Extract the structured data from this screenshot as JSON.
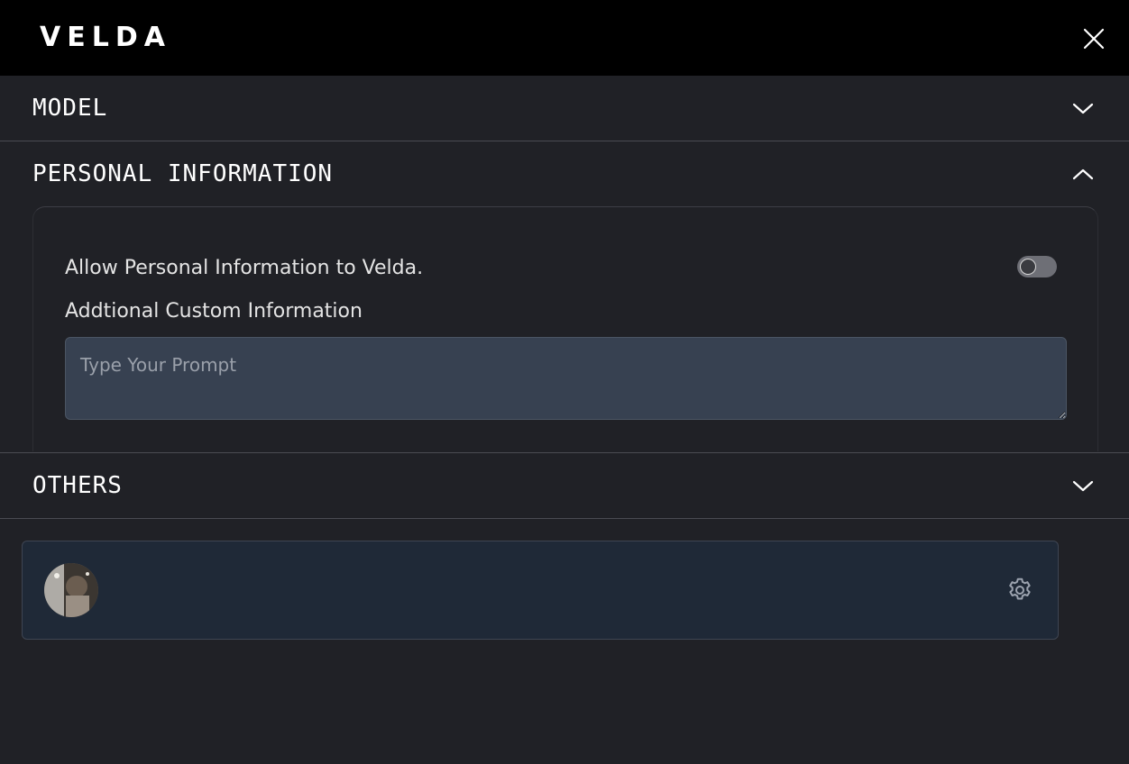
{
  "header": {
    "logo_text": "VELDA"
  },
  "sections": {
    "model": {
      "title": "MODEL",
      "expanded": false
    },
    "personal": {
      "title": "PERSONAL INFORMATION",
      "expanded": true,
      "allow_label": "Allow Personal Information to Velda.",
      "allow_enabled": false,
      "custom_label": "Addtional Custom Information",
      "prompt_placeholder": "Type Your Prompt",
      "prompt_value": ""
    },
    "others": {
      "title": "OTHERS",
      "expanded": false
    }
  },
  "icons": {
    "close": "close-icon",
    "chevron_down": "chevron-down-icon",
    "chevron_up": "chevron-up-icon",
    "settings": "gear-icon"
  },
  "colors": {
    "background": "#202126",
    "topbar": "#000000",
    "input_bg": "#374151",
    "card_bg": "#1f2937"
  }
}
